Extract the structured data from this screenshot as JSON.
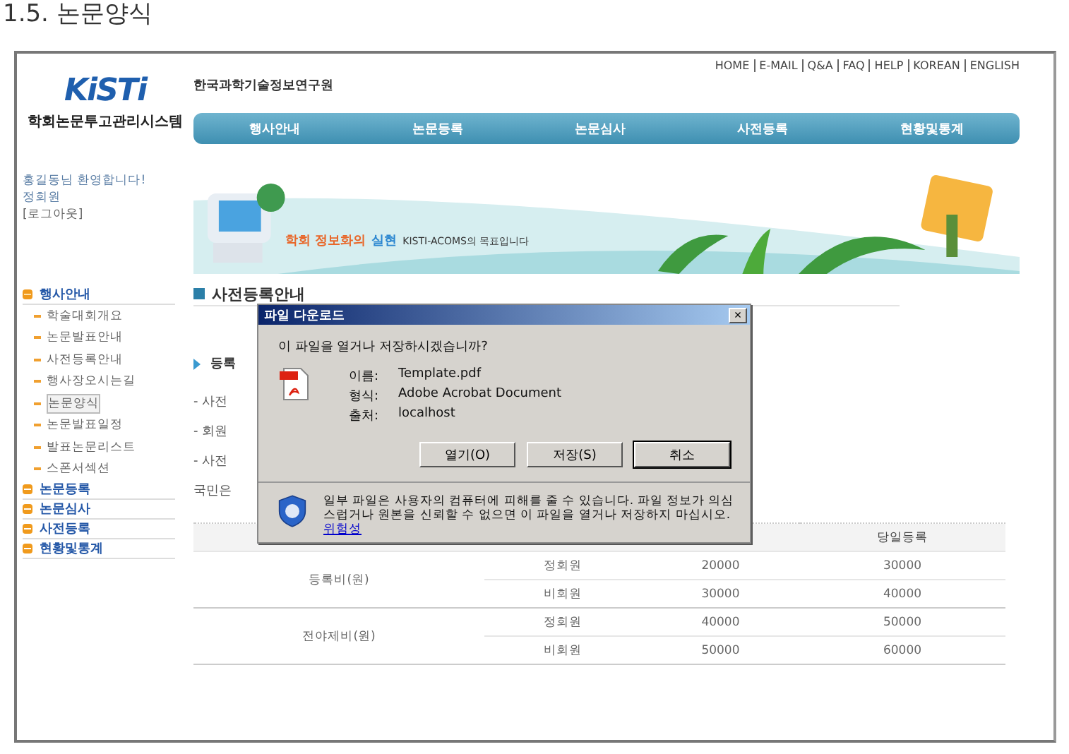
{
  "doc_heading": "1.5. 논문양식",
  "site": {
    "logo": "KiSTi",
    "system_name": "학회논문투고관리시스템",
    "org_name": "한국과학기술정보연구원",
    "top_links": [
      "HOME",
      "E-MAIL",
      "Q&A",
      "FAQ",
      "HELP",
      "KOREAN",
      "ENGLISH"
    ],
    "nav": [
      {
        "label": "행사안내",
        "selected": false
      },
      {
        "label": "논문등록",
        "selected": false
      },
      {
        "label": "논문심사",
        "selected": false
      },
      {
        "label": "사전등록",
        "selected": false
      },
      {
        "label": "현황및통계",
        "selected": false
      }
    ],
    "greeting": [
      "홍길동님 환영합니다!",
      "정회원",
      "[로그아웃]"
    ],
    "banner": {
      "slogan_a": "학회 정보화의",
      "slogan_b": "실현",
      "slogan_c": "KISTI-ACOMS의 목표입니다"
    },
    "sidebar": [
      {
        "label": "행사안내",
        "expanded": true,
        "children": [
          {
            "label": "학술대회개요",
            "selected": false
          },
          {
            "label": "논문발표안내",
            "selected": false
          },
          {
            "label": "사전등록안내",
            "selected": false
          },
          {
            "label": "행사장오시는길",
            "selected": false
          },
          {
            "label": "논문양식",
            "selected": true
          },
          {
            "label": "논문발표일정",
            "selected": false
          },
          {
            "label": "발표논문리스트",
            "selected": false
          },
          {
            "label": "스폰서섹션",
            "selected": false
          }
        ]
      },
      {
        "label": "논문등록",
        "expanded": false
      },
      {
        "label": "논문심사",
        "expanded": false
      },
      {
        "label": "사전등록",
        "expanded": false
      },
      {
        "label": "현황및통계",
        "expanded": false
      }
    ],
    "section_title": "사전등록안내",
    "subsection": "등록",
    "lines": [
      "- 사전",
      "- 회원",
      "- 사전",
      "국민은"
    ],
    "table": {
      "column_4": "당일등록",
      "groups": [
        {
          "name": "등록비(원)",
          "rows": [
            [
              "정회원",
              "20000",
              "30000"
            ],
            [
              "비회원",
              "30000",
              "40000"
            ]
          ]
        },
        {
          "name": "전야제비(원)",
          "rows": [
            [
              "정회원",
              "40000",
              "50000"
            ],
            [
              "비회원",
              "50000",
              "60000"
            ]
          ]
        }
      ]
    }
  },
  "dialog": {
    "title": "파일 다운로드",
    "close": "×",
    "question": "이 파일을 열거나 저장하시겠습니까?",
    "fields": [
      {
        "label": "이름:",
        "value": "Template.pdf"
      },
      {
        "label": "형식:",
        "value": "Adobe Acrobat Document"
      },
      {
        "label": "출처:",
        "value": "localhost"
      }
    ],
    "buttons": [
      {
        "label": "열기(O)",
        "selected": false
      },
      {
        "label": "저장(S)",
        "selected": false
      },
      {
        "label": "취소",
        "selected": true
      }
    ],
    "warning": "일부 파일은 사용자의 컴퓨터에 피해를 줄 수 있습니다. 파일 정보가 의심스럽거나 원본을 신뢰할 수 없으면 이 파일을 열거나 저장하지 마십시오.",
    "link": "위험성"
  }
}
